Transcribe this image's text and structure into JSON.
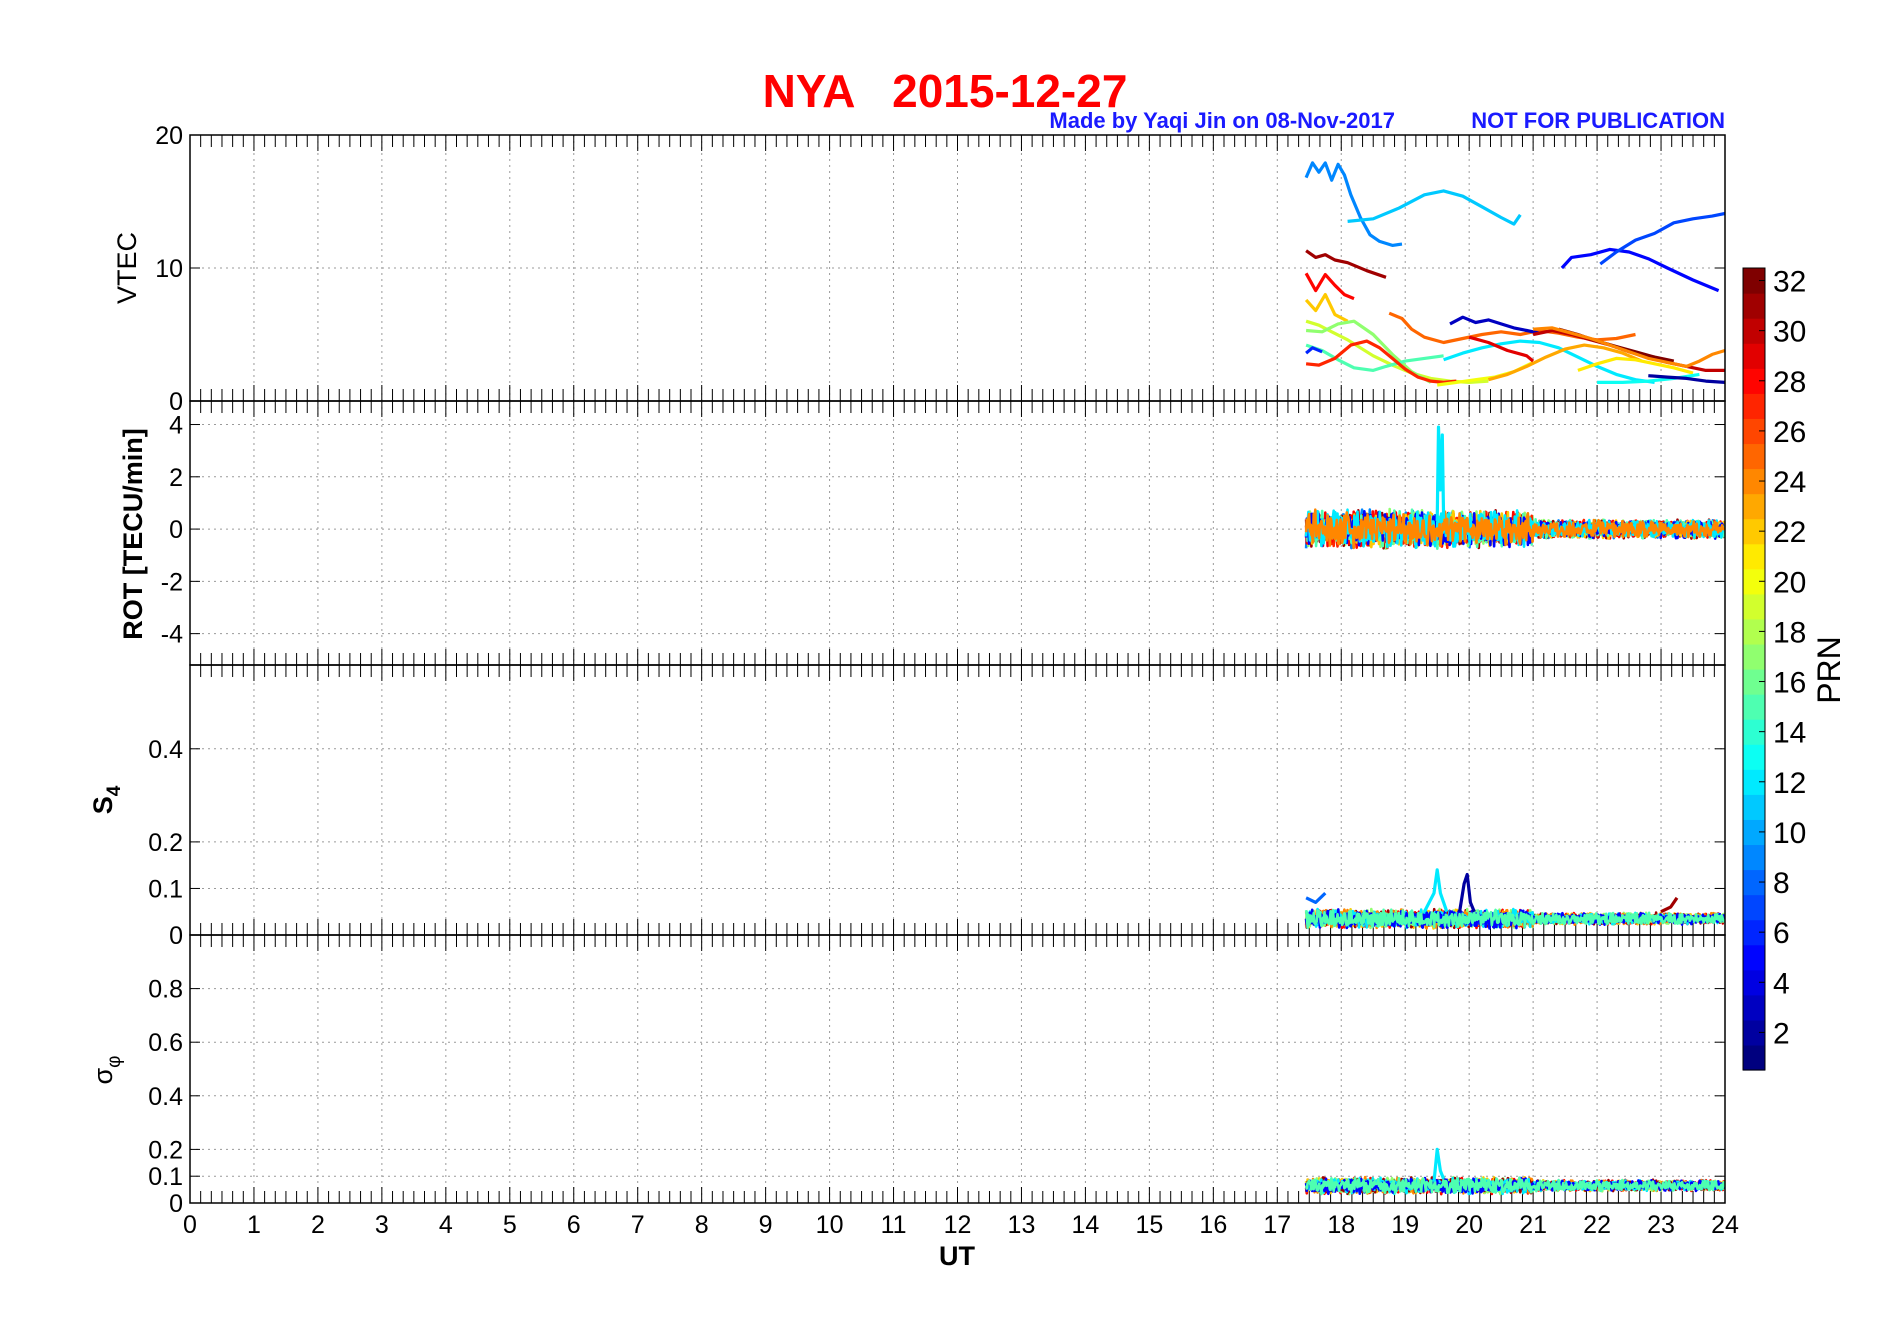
{
  "title": "NYA   2015-12-27",
  "credit": "Made by Yaqi Jin on 08-Nov-2017",
  "notice": "NOT FOR PUBLICATION",
  "chart_data": {
    "type": "line",
    "xlabel": "UT",
    "xlim": [
      0,
      24
    ],
    "x_ticks": [
      "0",
      "1",
      "2",
      "3",
      "4",
      "5",
      "6",
      "7",
      "8",
      "9",
      "10",
      "11",
      "12",
      "13",
      "14",
      "15",
      "16",
      "17",
      "18",
      "19",
      "20",
      "21",
      "22",
      "23",
      "24"
    ],
    "grid": true,
    "colorbar": {
      "label": "PRN",
      "range": [
        1,
        32
      ],
      "ticks": [
        "2",
        "4",
        "6",
        "8",
        "10",
        "12",
        "14",
        "16",
        "18",
        "20",
        "22",
        "24",
        "26",
        "28",
        "30",
        "32"
      ],
      "colormap": [
        "#00007f",
        "#0000ff",
        "#007fff",
        "#00ffff",
        "#7fff7f",
        "#ffff00",
        "#ff7f00",
        "#ff0000",
        "#7f0000"
      ]
    },
    "panels": [
      {
        "id": "vtec",
        "ylabel": "VTEC",
        "ylim": [
          0,
          20
        ],
        "y_ticks": [
          {
            "v": 0,
            "label": "0"
          },
          {
            "v": 10,
            "label": "10"
          },
          {
            "v": 20,
            "label": "20"
          }
        ],
        "series": [
          {
            "prn": 9,
            "x": [
              17.45,
              17.55,
              17.65,
              17.75,
              17.85,
              17.95,
              18.05,
              18.15,
              18.3,
              18.45,
              18.6,
              18.8,
              18.95
            ],
            "y": [
              16.8,
              17.9,
              17.2,
              17.9,
              16.6,
              17.8,
              17.0,
              15.5,
              13.8,
              12.5,
              12.0,
              11.7,
              11.8
            ]
          },
          {
            "prn": 11,
            "x": [
              18.1,
              18.5,
              18.9,
              19.3,
              19.6,
              19.9,
              20.2,
              20.5,
              20.7,
              20.8
            ],
            "y": [
              13.5,
              13.7,
              14.5,
              15.5,
              15.8,
              15.4,
              14.6,
              13.8,
              13.3,
              14.0
            ]
          },
          {
            "prn": 5,
            "x": [
              21.45,
              21.6,
              21.9,
              22.2,
              22.5,
              22.8,
              23.1,
              23.5,
              23.9
            ],
            "y": [
              10.0,
              10.8,
              11.0,
              11.4,
              11.2,
              10.7,
              10.0,
              9.1,
              8.3
            ]
          },
          {
            "prn": 7,
            "x": [
              22.05,
              22.3,
              22.6,
              22.9,
              23.2,
              23.5,
              23.8,
              24.0
            ],
            "y": [
              10.3,
              11.2,
              12.1,
              12.6,
              13.4,
              13.7,
              13.9,
              14.1
            ]
          },
          {
            "prn": 31,
            "x": [
              17.45,
              17.6,
              17.75,
              17.9,
              18.1,
              18.4,
              18.7
            ],
            "y": [
              11.3,
              10.8,
              11.0,
              10.6,
              10.4,
              9.8,
              9.3
            ]
          },
          {
            "prn": 28,
            "x": [
              17.45,
              17.6,
              17.75,
              17.9,
              18.05,
              18.2
            ],
            "y": [
              9.6,
              8.3,
              9.5,
              8.7,
              8.0,
              7.7
            ]
          },
          {
            "prn": 22,
            "x": [
              17.45,
              17.6,
              17.75,
              17.9,
              18.1
            ],
            "y": [
              7.6,
              6.8,
              8.0,
              6.5,
              6.0
            ]
          },
          {
            "prn": 19,
            "x": [
              17.45,
              17.65,
              17.85,
              18.1,
              18.3,
              18.5,
              18.8,
              19.1,
              19.4,
              19.7,
              20.0,
              20.3
            ],
            "y": [
              6.0,
              5.7,
              5.2,
              4.6,
              4.0,
              3.4,
              2.7,
              2.1,
              1.7,
              1.5,
              1.4,
              1.5
            ]
          },
          {
            "prn": 17,
            "x": [
              17.45,
              17.7,
              17.95,
              18.2,
              18.5,
              18.8,
              19.1,
              19.4
            ],
            "y": [
              5.3,
              5.2,
              5.8,
              6.0,
              5.0,
              3.5,
              2.2,
              1.4
            ]
          },
          {
            "prn": 15,
            "x": [
              17.45,
              17.7,
              17.95,
              18.2,
              18.5,
              18.7,
              19.0,
              19.3,
              19.6
            ],
            "y": [
              4.2,
              3.8,
              3.1,
              2.5,
              2.3,
              2.6,
              3.0,
              3.2,
              3.4
            ]
          },
          {
            "prn": 27,
            "x": [
              17.45,
              17.65,
              17.9,
              18.15,
              18.4,
              18.6,
              18.8,
              19.0,
              19.2,
              19.4,
              19.6,
              19.8
            ],
            "y": [
              2.8,
              2.7,
              3.2,
              4.2,
              4.5,
              4.0,
              3.2,
              2.4,
              1.8,
              1.5,
              1.4,
              1.5
            ]
          },
          {
            "prn": 6,
            "x": [
              17.45,
              17.55,
              17.7
            ],
            "y": [
              3.6,
              4.0,
              3.7
            ]
          },
          {
            "prn": 25,
            "x": [
              18.75,
              18.95,
              19.1,
              19.3,
              19.6,
              19.9,
              20.2,
              20.5,
              20.8,
              21.1,
              21.4,
              21.7,
              22.0,
              22.3,
              22.6
            ],
            "y": [
              6.6,
              6.2,
              5.4,
              4.8,
              4.4,
              4.7,
              5.0,
              5.2,
              5.0,
              5.3,
              5.1,
              4.8,
              4.6,
              4.7,
              5.0
            ]
          },
          {
            "prn": 3,
            "x": [
              19.7,
              19.9,
              20.1,
              20.3,
              20.5,
              20.7,
              20.9,
              21.1
            ],
            "y": [
              5.8,
              6.3,
              5.9,
              6.1,
              5.8,
              5.5,
              5.3,
              5.1
            ]
          },
          {
            "prn": 12,
            "x": [
              19.6,
              19.9,
              20.2,
              20.5,
              20.8,
              21.1,
              21.4,
              21.7,
              22.0,
              22.3,
              22.6,
              22.9
            ],
            "y": [
              3.1,
              3.6,
              4.0,
              4.3,
              4.5,
              4.4,
              4.0,
              3.3,
              2.6,
              2.0,
              1.6,
              1.4
            ]
          },
          {
            "prn": 20,
            "x": [
              19.5,
              19.8,
              20.1,
              20.4,
              20.7,
              21.0
            ],
            "y": [
              1.2,
              1.4,
              1.6,
              1.8,
              2.2,
              2.9
            ]
          },
          {
            "prn": 23,
            "x": [
              20.3,
              20.6,
              20.9,
              21.2,
              21.5,
              21.8,
              22.1,
              22.4,
              22.7
            ],
            "y": [
              1.6,
              2.0,
              2.6,
              3.3,
              3.9,
              4.2,
              4.0,
              3.6,
              3.0
            ]
          },
          {
            "prn": 29,
            "x": [
              20.0,
              20.3,
              20.6,
              20.9,
              21.0
            ],
            "y": [
              4.8,
              4.4,
              3.8,
              3.4,
              3.0
            ]
          },
          {
            "prn": 30,
            "x": [
              21.0,
              21.3,
              21.6,
              21.9,
              22.2,
              22.5,
              22.8,
              23.1,
              23.4,
              23.7,
              24.0
            ],
            "y": [
              5.0,
              5.3,
              5.0,
              4.6,
              4.2,
              3.7,
              3.3,
              2.9,
              2.6,
              2.3,
              2.3
            ]
          },
          {
            "prn": 32,
            "x": [
              21.4,
              21.7,
              22.0,
              22.3,
              22.6,
              22.9,
              23.2
            ],
            "y": [
              5.4,
              5.0,
              4.5,
              4.1,
              3.7,
              3.3,
              3.0
            ]
          },
          {
            "prn": 24,
            "x": [
              21.0,
              21.3,
              21.6,
              21.9,
              22.2,
              22.5,
              22.8,
              23.1,
              23.4,
              23.6,
              23.8,
              24.0
            ],
            "y": [
              5.4,
              5.5,
              5.1,
              4.7,
              4.2,
              3.7,
              3.2,
              2.9,
              2.6,
              3.0,
              3.5,
              3.8
            ]
          },
          {
            "prn": 21,
            "x": [
              21.7,
              22.0,
              22.3,
              22.6,
              22.9,
              23.2,
              23.5
            ],
            "y": [
              2.3,
              2.8,
              3.2,
              3.1,
              2.8,
              2.5,
              2.1
            ]
          },
          {
            "prn": 13,
            "x": [
              22.0,
              22.4,
              22.8,
              23.2,
              23.6
            ],
            "y": [
              1.4,
              1.4,
              1.5,
              1.7,
              2.0
            ]
          },
          {
            "prn": 2,
            "x": [
              22.8,
              23.1,
              23.4,
              23.7,
              24.0
            ],
            "y": [
              1.9,
              1.8,
              1.7,
              1.5,
              1.4
            ]
          }
        ]
      },
      {
        "id": "rot",
        "ylabel": "ROT [TECU/min]",
        "ylim": [
          -5.2,
          4.9
        ],
        "y_ticks": [
          {
            "v": 4,
            "label": "4"
          },
          {
            "v": 2,
            "label": "2"
          },
          {
            "v": 0,
            "label": "0"
          },
          {
            "v": -2,
            "label": "-2"
          },
          {
            "v": -4,
            "label": "-4"
          }
        ],
        "noise": {
          "x_start": 17.45,
          "x_end": 24.0,
          "baseline": 0.0,
          "amplitude": 0.7,
          "amplitude_late": 0.35,
          "prns": [
            9,
            17,
            27,
            31,
            28,
            22,
            15,
            5,
            12,
            24
          ]
        },
        "series": [
          {
            "prn": 12,
            "x": [
              19.5,
              19.52,
              19.55,
              19.58,
              19.6
            ],
            "y": [
              0.3,
              3.9,
              1.5,
              3.6,
              0.4
            ]
          }
        ]
      },
      {
        "id": "s4",
        "ylabel": "S4",
        "ylim": [
          0,
          0.58
        ],
        "y_ticks": [
          {
            "v": 0,
            "label": "0"
          },
          {
            "v": 0.1,
            "label": "0.1"
          },
          {
            "v": 0.2,
            "label": "0.2"
          },
          {
            "v": 0.4,
            "label": "0.4"
          }
        ],
        "noise": {
          "x_start": 17.45,
          "x_end": 24.0,
          "baseline": 0.035,
          "amplitude": 0.02,
          "amplitude_late": 0.012,
          "prns": [
            28,
            22,
            31,
            17,
            24,
            12,
            5,
            15
          ]
        },
        "series": [
          {
            "prn": 12,
            "x": [
              19.3,
              19.45,
              19.5,
              19.55,
              19.65
            ],
            "y": [
              0.05,
              0.09,
              0.14,
              0.09,
              0.05
            ]
          },
          {
            "prn": 2,
            "x": [
              19.85,
              19.92,
              19.97,
              20.02,
              20.08
            ],
            "y": [
              0.05,
              0.11,
              0.13,
              0.07,
              0.05
            ]
          },
          {
            "prn": 8,
            "x": [
              17.45,
              17.6,
              17.75
            ],
            "y": [
              0.08,
              0.07,
              0.09
            ]
          },
          {
            "prn": 31,
            "x": [
              23.0,
              23.15,
              23.25
            ],
            "y": [
              0.05,
              0.06,
              0.08
            ]
          }
        ]
      },
      {
        "id": "sigma",
        "ylabel": "σφ",
        "ylim": [
          0,
          1.0
        ],
        "y_ticks": [
          {
            "v": 0,
            "label": "0"
          },
          {
            "v": 0.1,
            "label": "0.1"
          },
          {
            "v": 0.2,
            "label": "0.2"
          },
          {
            "v": 0.4,
            "label": "0.4"
          },
          {
            "v": 0.6,
            "label": "0.6"
          },
          {
            "v": 0.8,
            "label": "0.8"
          }
        ],
        "noise": {
          "x_start": 17.45,
          "x_end": 24.0,
          "baseline": 0.065,
          "amplitude": 0.03,
          "amplitude_late": 0.02,
          "prns": [
            28,
            22,
            24,
            17,
            31,
            12,
            5,
            15
          ]
        },
        "series": [
          {
            "prn": 12,
            "x": [
              19.45,
              19.5,
              19.55,
              19.6
            ],
            "y": [
              0.08,
              0.2,
              0.12,
              0.09
            ]
          }
        ]
      }
    ]
  }
}
